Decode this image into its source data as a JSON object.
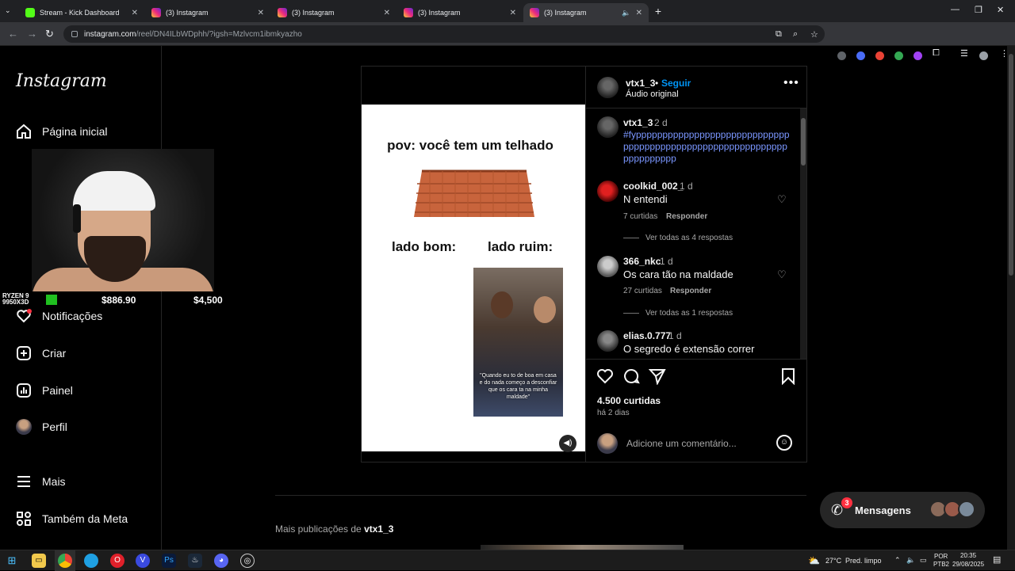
{
  "browser": {
    "tabs": [
      {
        "title": "Stream - Kick Dashboard",
        "favicon": "kick",
        "active": false
      },
      {
        "title": "(3) Instagram",
        "favicon": "instagram",
        "active": false
      },
      {
        "title": "(3) Instagram",
        "favicon": "instagram",
        "active": false
      },
      {
        "title": "(3) Instagram",
        "favicon": "instagram",
        "active": false
      },
      {
        "title": "(3) Instagram",
        "favicon": "instagram",
        "active": true
      }
    ],
    "url_host": "instagram.com",
    "url_path": "/reel/DN4ILbWDphh/?igsh=Mzlvcm1ibmkyazho"
  },
  "sidebar": {
    "logo": "Instagram",
    "items": [
      {
        "label": "Página inicial",
        "icon": "home-icon"
      },
      {
        "label": "Notificações",
        "icon": "heart-icon"
      },
      {
        "label": "Criar",
        "icon": "plus-square-icon"
      },
      {
        "label": "Painel",
        "icon": "chart-icon"
      },
      {
        "label": "Perfil",
        "icon": "avatar"
      },
      {
        "label": "Mais",
        "icon": "hamburger-icon"
      },
      {
        "label": "Também da Meta",
        "icon": "meta-icon"
      }
    ]
  },
  "stream_overlay": {
    "cpu_label": "RYZEN 9 9950X3D",
    "amount_1": "$886.90",
    "amount_2": "$4,500"
  },
  "post": {
    "author": "vtx1_3",
    "follow_label": "Seguir",
    "separator": "•",
    "audio": "Áudio original",
    "meme": {
      "title": "pov: você tem um telhado",
      "left_label": "lado bom:",
      "right_label": "lado ruim:",
      "photo_caption": "\"Quando eu to de boa em casa e do nada começo a desconfiar que os cara ta na minha maldade\""
    },
    "caption": {
      "user": "vtx1_3",
      "time": "2 d",
      "text": "#fypppppppppppppppppppppppppppppppppppppppppppppppppppppppppppppppppppppp"
    },
    "comments": [
      {
        "user": "coolkid_002_",
        "time": "1 d",
        "text": "N entendi",
        "likes": "7 curtidas",
        "reply": "Responder",
        "view_replies": "Ver todas as 4 respostas"
      },
      {
        "user": "366_nkc",
        "time": "1 d",
        "text": "Os cara tão na maldade",
        "likes": "27 curtidas",
        "reply": "Responder",
        "view_replies": "Ver todas as 1 respostas"
      },
      {
        "user": "elias.0.777",
        "time": "1 d",
        "text": "O segredo é extensão correr"
      }
    ],
    "likes": "4.500 curtidas",
    "posted": "há 2 dias",
    "comment_placeholder": "Adicione um comentário..."
  },
  "more_posts": {
    "prefix": "Mais publicações de",
    "user": "vtx1_3"
  },
  "messages": {
    "label": "Mensagens",
    "badge": "3"
  },
  "taskbar": {
    "weather": "27°C",
    "weather_desc": "Pred. limpo",
    "lang_1": "POR",
    "lang_2": "PTB2",
    "time": "20:35",
    "date": "29/08/2025"
  },
  "colors": {
    "link_blue": "#0095f6",
    "hashtag": "#7a96ff",
    "notif_red": "#ff3040"
  }
}
